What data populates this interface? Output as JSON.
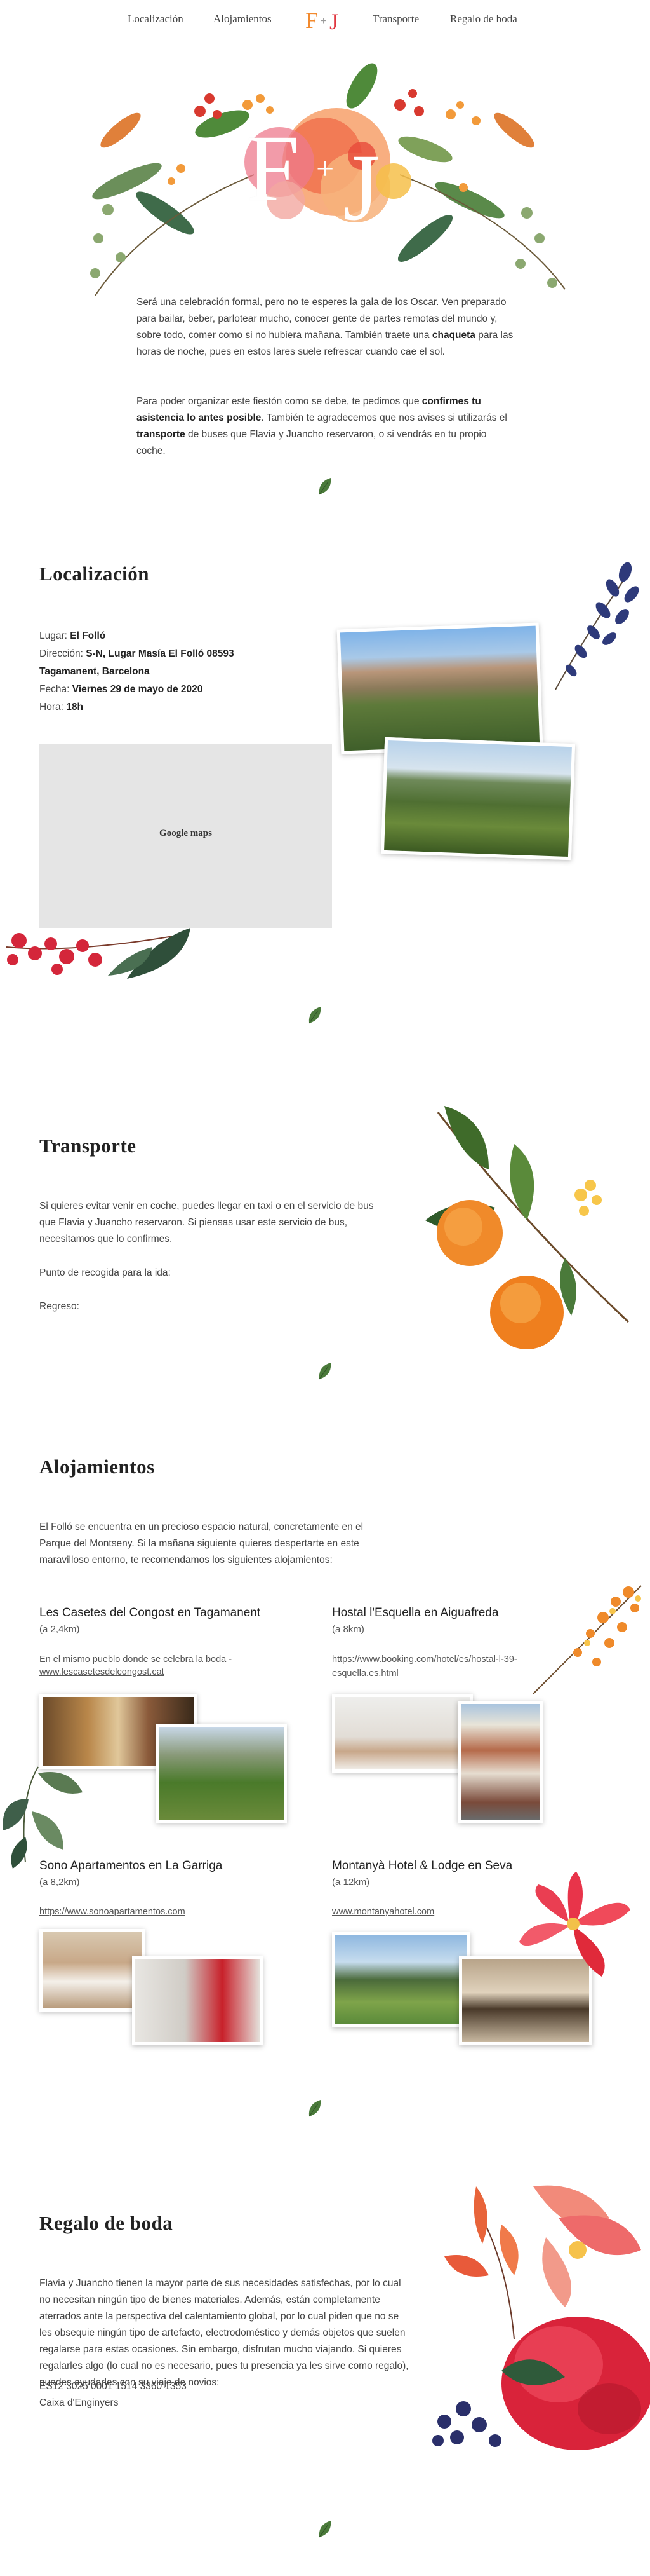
{
  "nav": {
    "items": [
      "Localización",
      "Alojamientos",
      "Transporte",
      "Regalo de boda"
    ],
    "logo": "F+J"
  },
  "hero": {
    "monogram_left": "F",
    "monogram_plus": "+",
    "monogram_right": "J",
    "intro_1_a": "Será una celebración formal, pero no te esperes la gala de los Oscar. Ven preparado para bailar, beber, parlotear mucho, conocer gente de partes remotas del mundo y, sobre todo, comer como si no hubiera mañana. También traete una ",
    "intro_1_b": "chaqueta",
    "intro_1_c": " para las horas de noche, pues en estos lares suele refrescar cuando cae el sol.",
    "intro_2_a": "Para poder organizar este fiestón como se debe, te pedimos que ",
    "intro_2_b": "confirmes tu asistencia lo antes posible",
    "intro_2_c": ". También te agradecemos que nos avises si utilizarás el ",
    "intro_2_d": "transporte",
    "intro_2_e": " de buses que Flavia y Juancho reservaron, o si vendrás en tu propio coche."
  },
  "localizacion": {
    "title": "Localización",
    "lugar_label": "Lugar: ",
    "lugar": "El Folló",
    "direccion_label": "Dirección: ",
    "direccion": "S-N, Lugar Masía El Folló 08593 Tagamanent, Barcelona",
    "fecha_label": "Fecha: ",
    "fecha": "Viernes 29 de mayo de 2020",
    "hora_label": "Hora: ",
    "hora": "18h",
    "map_label": "Google maps"
  },
  "transporte": {
    "title": "Transporte",
    "text": "Si quieres evitar venir en coche, puedes llegar en taxi o en el servicio de bus que Flavia y Juancho reservaron. Si piensas usar este servicio de bus, necesitamos que lo confirmes.",
    "pickup": "Punto de recogida para la ida:",
    "return": "Regreso:"
  },
  "alojamientos": {
    "title": "Alojamientos",
    "intro": "El Folló se encuentra en un precioso espacio natural, concretamente en el Parque del Montseny. Si la mañana siguiente quieres despertarte en este maravilloso entorno, te recomendamos los siguientes alojamientos:",
    "hotels": [
      {
        "name": "Les Casetes del Congost en Tagamanent",
        "distance": "(a 2,4km)",
        "note": "En el mismo pueblo donde se celebra la boda -",
        "link": "www.lescasetesdelcongost.cat"
      },
      {
        "name": "Hostal l'Esquella en Aiguafreda",
        "distance": "(a 8km)",
        "note": "",
        "link": "https://www.booking.com/hotel/es/hostal-l-39-esquella.es.html"
      },
      {
        "name": "Sono Apartamentos en La Garriga",
        "distance": "(a 8,2km)",
        "note": "",
        "link": "https://www.sonoapartamentos.com"
      },
      {
        "name": "Montanyà Hotel & Lodge en Seva",
        "distance": "(a 12km)",
        "note": "",
        "link": "www.montanyahotel.com"
      }
    ]
  },
  "regalo": {
    "title": "Regalo de boda",
    "text": "Flavia y Juancho tienen la mayor parte de sus necesidades satisfechas, por lo cual no necesitan ningún tipo de bienes materiales. Además, están completamente aterrados ante la perspectiva del calentamiento global, por lo cual piden que no se les obsequie ningún tipo de artefacto, electrodoméstico y demás objetos que suelen regalarse para estas ocasiones. Sin embargo, disfrutan mucho viajando. Si quieres regalarles algo (lo cual no es necesario, pues tu presencia ya les sirve como regalo), puedes ayudarles con su viaje de novios:",
    "iban": "ES12 3025 0001 1514 3360 1353",
    "bank": "Caixa d'Enginyers"
  },
  "colors": {
    "accent_orange": "#f28a2e",
    "accent_red": "#e0363f",
    "leaf_green": "#4a7a3a",
    "text": "#444444"
  }
}
